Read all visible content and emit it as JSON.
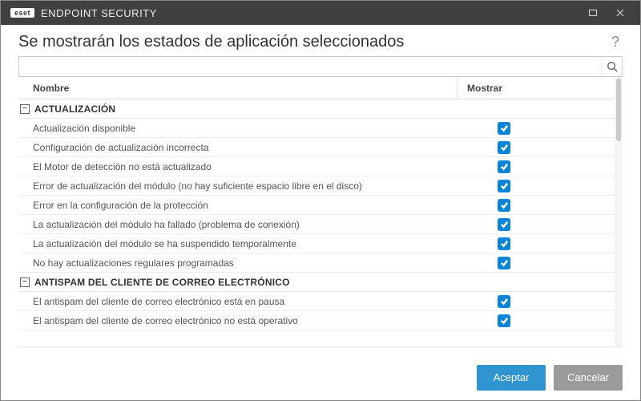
{
  "brand_badge": "eset",
  "brand_text": "ENDPOINT SECURITY",
  "page_title": "Se mostrarán los estados de aplicación seleccionados",
  "help_symbol": "?",
  "search": {
    "value": "",
    "placeholder": ""
  },
  "columns": {
    "name": "Nombre",
    "show": "Mostrar"
  },
  "groups": [
    {
      "label": "ACTUALIZACIÓN",
      "expanded": true,
      "items": [
        {
          "name": "Actualización disponible",
          "show": true
        },
        {
          "name": "Configuración de actualización incorrecta",
          "show": true
        },
        {
          "name": "El Motor de detección no está actualizado",
          "show": true
        },
        {
          "name": "Error de actualización del módulo (no hay suficiente espacio libre en el disco)",
          "show": true
        },
        {
          "name": "Error en la configuración de la protección",
          "show": true
        },
        {
          "name": "La actualización del módulo ha fallado (problema de conexión)",
          "show": true
        },
        {
          "name": "La actualización del módulo se ha suspendido temporalmente",
          "show": true
        },
        {
          "name": "No hay actualizaciones regulares programadas",
          "show": true
        }
      ]
    },
    {
      "label": "ANTISPAM DEL CLIENTE DE CORREO ELECTRÓNICO",
      "expanded": true,
      "items": [
        {
          "name": "El antispam del cliente de correo electrónico está en pausa",
          "show": true
        },
        {
          "name": "El antispam del cliente de correo electrónico no está operativo",
          "show": true
        }
      ]
    }
  ],
  "footer": {
    "accept": "Aceptar",
    "cancel": "Cancelar"
  }
}
